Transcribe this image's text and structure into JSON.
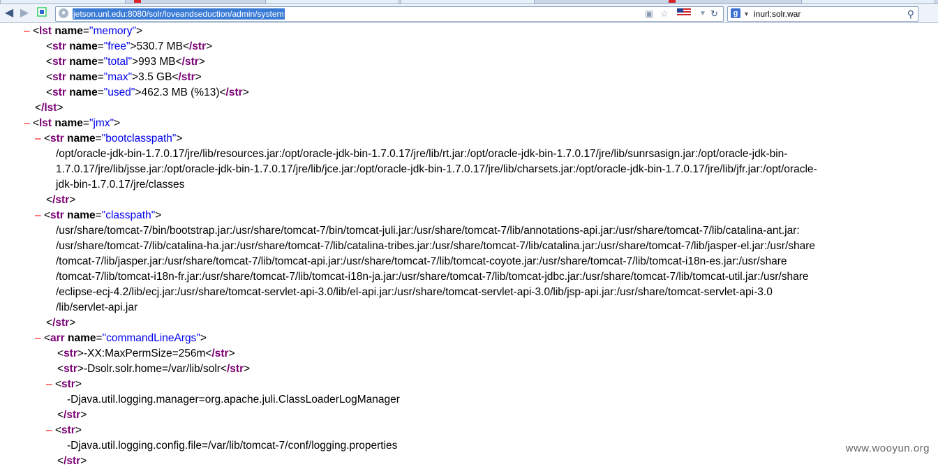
{
  "browser": {
    "url": "jetson.unl.edu:8080/solr/loveandseduction/admin/system",
    "search_value": "inurl:solr.war",
    "search_engine_icon": "g",
    "icons": [
      "back-arrow-icon",
      "forward-arrow-icon",
      "page-icon",
      "globe-icon",
      "feed-icon",
      "star-icon",
      "us-flag-icon",
      "dropdown-icon",
      "reload-icon",
      "search-icon"
    ]
  },
  "glyphs": {
    "collapse": "–",
    "lt": "<",
    "gt": ">",
    "slash": "/",
    "eq": "=",
    "q": "\""
  },
  "xml": {
    "memory": {
      "tag": "lst",
      "attr": "name",
      "name": "memory",
      "items": [
        {
          "tag": "str",
          "attr": "name",
          "name": "free",
          "value": "530.7 MB"
        },
        {
          "tag": "str",
          "attr": "name",
          "name": "total",
          "value": "993 MB"
        },
        {
          "tag": "str",
          "attr": "name",
          "name": "max",
          "value": "3.5 GB"
        },
        {
          "tag": "str",
          "attr": "name",
          "name": "used",
          "value": "462.3 MB (%13)"
        }
      ]
    },
    "jmx": {
      "tag": "lst",
      "attr": "name",
      "name": "jmx",
      "bootclasspath": {
        "tag": "str",
        "attr": "name",
        "name": "bootclasspath",
        "lines": [
          "/opt/oracle-jdk-bin-1.7.0.17/jre/lib/resources.jar:/opt/oracle-jdk-bin-1.7.0.17/jre/lib/rt.jar:/opt/oracle-jdk-bin-1.7.0.17/jre/lib/sunrsasign.jar:/opt/oracle-jdk-bin-",
          "1.7.0.17/jre/lib/jsse.jar:/opt/oracle-jdk-bin-1.7.0.17/jre/lib/jce.jar:/opt/oracle-jdk-bin-1.7.0.17/jre/lib/charsets.jar:/opt/oracle-jdk-bin-1.7.0.17/jre/lib/jfr.jar:/opt/oracle-",
          "jdk-bin-1.7.0.17/jre/classes"
        ]
      },
      "classpath": {
        "tag": "str",
        "attr": "name",
        "name": "classpath",
        "lines": [
          "/usr/share/tomcat-7/bin/bootstrap.jar:/usr/share/tomcat-7/bin/tomcat-juli.jar:/usr/share/tomcat-7/lib/annotations-api.jar:/usr/share/tomcat-7/lib/catalina-ant.jar:",
          "/usr/share/tomcat-7/lib/catalina-ha.jar:/usr/share/tomcat-7/lib/catalina-tribes.jar:/usr/share/tomcat-7/lib/catalina.jar:/usr/share/tomcat-7/lib/jasper-el.jar:/usr/share",
          "/tomcat-7/lib/jasper.jar:/usr/share/tomcat-7/lib/tomcat-api.jar:/usr/share/tomcat-7/lib/tomcat-coyote.jar:/usr/share/tomcat-7/lib/tomcat-i18n-es.jar:/usr/share",
          "/tomcat-7/lib/tomcat-i18n-fr.jar:/usr/share/tomcat-7/lib/tomcat-i18n-ja.jar:/usr/share/tomcat-7/lib/tomcat-jdbc.jar:/usr/share/tomcat-7/lib/tomcat-util.jar:/usr/share",
          "/eclipse-ecj-4.2/lib/ecj.jar:/usr/share/tomcat-servlet-api-3.0/lib/el-api.jar:/usr/share/tomcat-servlet-api-3.0/lib/jsp-api.jar:/usr/share/tomcat-servlet-api-3.0",
          "/lib/servlet-api.jar"
        ]
      },
      "commandLineArgs": {
        "tag": "arr",
        "attr": "name",
        "name": "commandLineArgs",
        "inline_items": [
          "-XX:MaxPermSize=256m",
          "-Dsolr.solr.home=/var/lib/solr"
        ],
        "block_items": [
          "-Djava.util.logging.manager=org.apache.juli.ClassLoaderLogManager",
          "-Djava.util.logging.config.file=/var/lib/tomcat-7/conf/logging.properties"
        ]
      }
    }
  },
  "watermark": "www.wooyun.org"
}
